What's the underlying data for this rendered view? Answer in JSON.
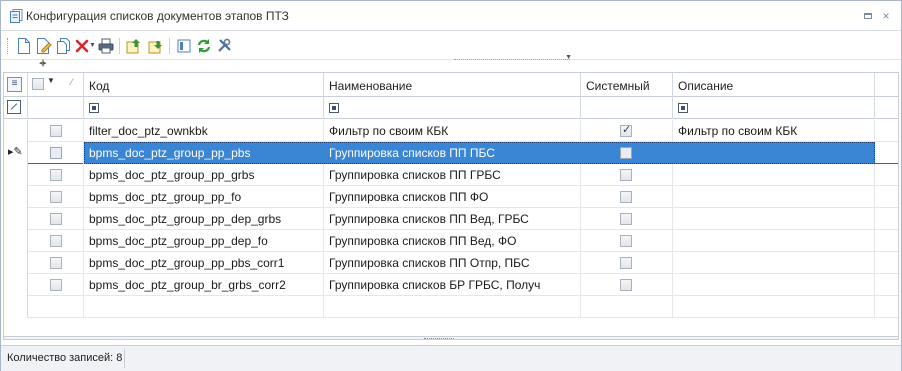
{
  "window": {
    "title": "Конфигурация списков документов этапов ПТЗ",
    "restore_icon": "restore-icon",
    "close_icon": "×"
  },
  "toolbar": {
    "buttons": [
      {
        "name": "new-document-icon",
        "color": "#4a7fc1"
      },
      {
        "name": "edit-document-icon",
        "color": "#d19a2a"
      },
      {
        "name": "copy-document-icon",
        "color": "#4a7fc1"
      },
      {
        "name": "delete-icon",
        "color": "#d9262b"
      },
      {
        "name": "print-icon",
        "color": "#4d5d73"
      },
      {
        "name": "move-up-icon",
        "color": "#3c8f3c"
      },
      {
        "name": "move-down-icon",
        "color": "#3c8f3c"
      },
      {
        "name": "columns-icon",
        "color": "#4a7fc1"
      },
      {
        "name": "refresh-icon",
        "color": "#2e9c3b"
      },
      {
        "name": "settings-icon",
        "color": "#6a7a92"
      }
    ]
  },
  "grid": {
    "columns": [
      {
        "key": "kod",
        "label": "Код"
      },
      {
        "key": "name",
        "label": "Наименование"
      },
      {
        "key": "system",
        "label": "Системный"
      },
      {
        "key": "desc",
        "label": "Описание"
      }
    ],
    "rows": [
      {
        "code": "filter_doc_ptz_ownkbk",
        "name": "Фильтр по своим КБК",
        "system": true,
        "desc": "Фильтр по своим КБК",
        "selected": false
      },
      {
        "code": "bpms_doc_ptz_group_pp_pbs",
        "name": "Группировка списков ПП ПБС",
        "system": false,
        "desc": "",
        "selected": true
      },
      {
        "code": "bpms_doc_ptz_group_pp_grbs",
        "name": "Группировка списков ПП ГРБС",
        "system": false,
        "desc": "",
        "selected": false
      },
      {
        "code": "bpms_doc_ptz_group_pp_fo",
        "name": "Группировка списков ПП ФО",
        "system": false,
        "desc": "",
        "selected": false
      },
      {
        "code": "bpms_doc_ptz_group_pp_dep_grbs",
        "name": "Группировка списков ПП Вед, ГРБС",
        "system": false,
        "desc": "",
        "selected": false
      },
      {
        "code": "bpms_doc_ptz_group_pp_dep_fo",
        "name": "Группировка списков ПП Вед, ФО",
        "system": false,
        "desc": "",
        "selected": false
      },
      {
        "code": "bpms_doc_ptz_group_pp_pbs_corr1",
        "name": "Группировка списков ПП Отпр, ПБС",
        "system": false,
        "desc": "",
        "selected": false
      },
      {
        "code": "bpms_doc_ptz_group_br_grbs_corr2",
        "name": "Группировка списков БР ГРБС, Получ",
        "system": false,
        "desc": "",
        "selected": false
      }
    ],
    "selection_color": "#3b85d5"
  },
  "status": {
    "record_count": "Количество записей: 8"
  }
}
